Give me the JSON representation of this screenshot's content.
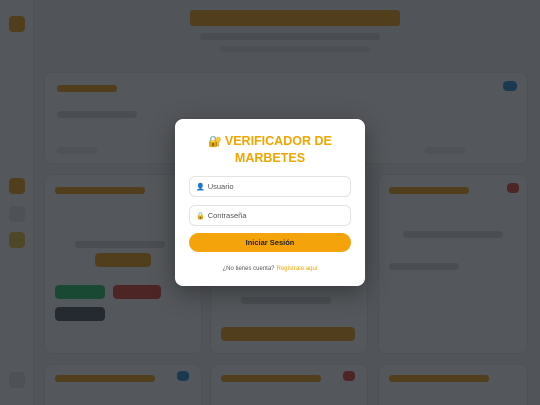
{
  "login": {
    "lock_icon": "🔐",
    "title": "VERIFICADOR DE MARBETES",
    "username_icon": "👤",
    "username_placeholder": "Usuario",
    "password_icon": "🔒",
    "password_placeholder": "Contraseña",
    "submit_label": "Iniciar Sesión",
    "register_prompt": "¿No tienes cuenta?",
    "register_link": "Regístrate aquí"
  },
  "colors": {
    "accent": "#f5a30a",
    "title": "#f0a500",
    "overlay": "rgba(18,22,28,0.72)"
  }
}
